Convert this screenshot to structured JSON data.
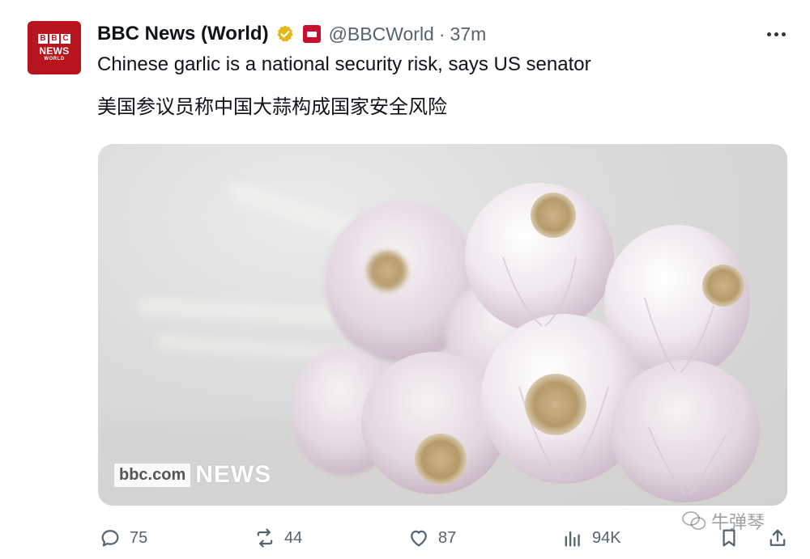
{
  "tweet": {
    "avatar": {
      "logo_letters": [
        "B",
        "B",
        "C"
      ],
      "line1": "NEWS",
      "line2": "WORLD"
    },
    "author": {
      "display_name": "BBC News (World)",
      "handle": "@BBCWorld",
      "separator": "·",
      "timestamp": "37m",
      "verified_icon": "verified-badge-icon",
      "affiliation_icon": "bbc-affiliate-icon"
    },
    "text_en": "Chinese garlic is a national security risk, says US senator",
    "text_zh": "美国参议员称中国大蒜构成国家安全风险",
    "media": {
      "subject": "garlic bulbs photo",
      "overlay_site": "bbc.com",
      "overlay_brand": "NEWS"
    },
    "actions": {
      "replies": "75",
      "reposts": "44",
      "likes": "87",
      "views": "94K"
    },
    "overlay_watermark": "牛弹琴"
  },
  "colors": {
    "text": "#0f1419",
    "secondary": "#536471",
    "bbc_red": "#b8141d",
    "verified_gold": "#e2b719"
  }
}
